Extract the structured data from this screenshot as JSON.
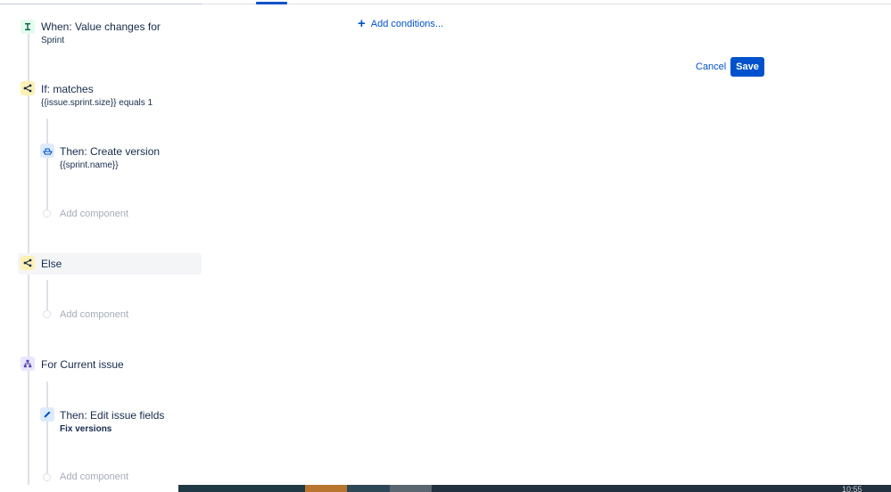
{
  "rule": {
    "trigger": {
      "title": "When: Value changes for",
      "detail": "Sprint"
    },
    "condition": {
      "title": "If: matches",
      "detail": "{{issue.sprint.size}} equals 1"
    },
    "action_create": {
      "title": "Then: Create version",
      "detail": "{{sprint.name}}"
    },
    "add_component_1": "Add component",
    "else_branch": {
      "title": "Else"
    },
    "add_component_2": "Add component",
    "branch": {
      "title": "For Current issue"
    },
    "action_edit": {
      "title": "Then: Edit issue fields",
      "detail": "Fix versions"
    },
    "add_component_3": "Add component"
  },
  "editor": {
    "add_conditions": "Add conditions...",
    "cancel": "Cancel",
    "save": "Save"
  },
  "taskbar": {
    "clock": "10:55"
  },
  "colors": {
    "accent": "#0052cc",
    "trigger_bg": "#e3fcef",
    "condition_bg": "#fff0b3",
    "action_bg": "#deebff",
    "branch_bg": "#eae6ff"
  },
  "icons": {
    "trigger": "trigger-icon",
    "condition": "condition-branch-icon",
    "create_version": "ship-icon",
    "branch": "hierarchy-icon",
    "edit": "pencil-icon"
  }
}
